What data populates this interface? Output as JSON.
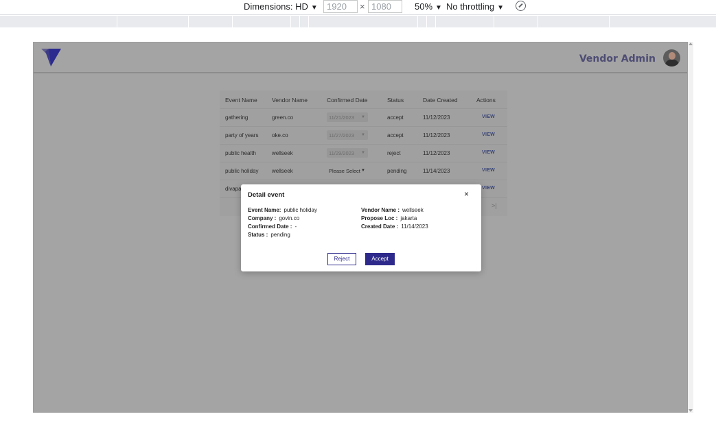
{
  "devtools": {
    "dimensions_label": "Dimensions: HD",
    "width": "1920",
    "times": "×",
    "height": "1080",
    "zoom": "50%",
    "throttling": "No throttling",
    "caret": "▼"
  },
  "header": {
    "admin_name": "Vendor Admin",
    "brand_color": "#2b2a8f"
  },
  "table": {
    "columns": [
      "Event Name",
      "Vendor Name",
      "Confirmed Date",
      "Status",
      "Date Created",
      "Actions"
    ],
    "rows": [
      {
        "event": "gathering",
        "vendor": "green.co",
        "confirmed": "11/21/2023",
        "status": "accept",
        "created": "11/12/2023",
        "action": "VIEW"
      },
      {
        "event": "party of years",
        "vendor": "oke.co",
        "confirmed": "11/27/2023",
        "status": "accept",
        "created": "11/12/2023",
        "action": "VIEW"
      },
      {
        "event": "public health",
        "vendor": "wellseek",
        "confirmed": "11/29/2023",
        "status": "reject",
        "created": "11/12/2023",
        "action": "VIEW"
      },
      {
        "event": "public holiday",
        "vendor": "wellseek",
        "confirmed": "Please Select",
        "status": "pending",
        "created": "11/14/2023",
        "action": "VIEW"
      },
      {
        "event": "divapa",
        "action": "VIEW"
      }
    ],
    "pager_last": ">|"
  },
  "modal": {
    "title": "Detail event",
    "close": "×",
    "event_name_label": "Event Name:",
    "event_name": "public holiday",
    "company_label": "Company :",
    "company": "govin.co",
    "confirmed_date_label": "Confirmed Date :",
    "confirmed_date": "-",
    "status_label": "Status :",
    "status": "pending",
    "vendor_name_label": "Vendor Name :",
    "vendor_name": "wellseek",
    "propose_loc_label": "Propose Loc :",
    "propose_loc": "jakarta",
    "created_date_label": "Created Date :",
    "created_date": "11/14/2023",
    "reject_label": "Reject",
    "accept_label": "Accept",
    "accent_color": "#2e2a8c"
  }
}
